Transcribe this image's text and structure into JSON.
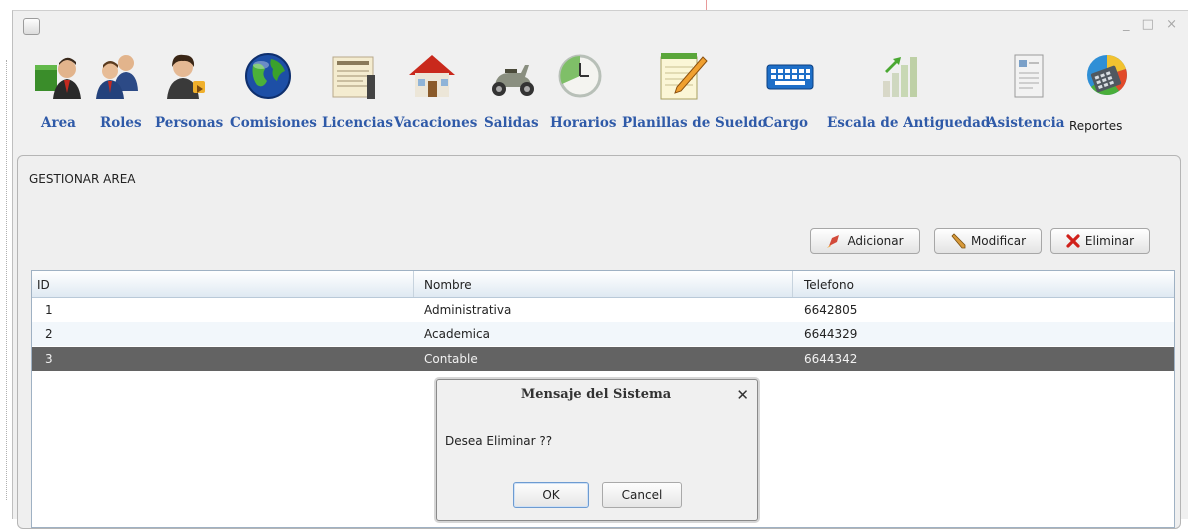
{
  "window": {
    "controls": "_ □ ×"
  },
  "toolbar": {
    "items": [
      {
        "label": "Area",
        "icon": "area-people-icon"
      },
      {
        "label": "Roles",
        "icon": "roles-people-icon"
      },
      {
        "label": "Personas",
        "icon": "personas-icon"
      },
      {
        "label": "Comisiones",
        "icon": "globe-icon"
      },
      {
        "label": "Licencias",
        "icon": "document-icon"
      },
      {
        "label": "Vacaciones",
        "icon": "house-icon"
      },
      {
        "label": "Salidas",
        "icon": "scooter-icon"
      },
      {
        "label": "Horarios",
        "icon": "clock-icon"
      },
      {
        "label": "Planillas de Sueldo",
        "icon": "notepad-pencil-icon"
      },
      {
        "label": "Cargo",
        "icon": "keyboard-icon"
      },
      {
        "label": "Escala de Antiguedad",
        "icon": "bar-chart-icon"
      },
      {
        "label": "Asistencia",
        "icon": "attendance-sheet-icon"
      },
      {
        "label": "Reportes",
        "icon": "calculator-pie-icon"
      }
    ]
  },
  "panel": {
    "title": "GESTIONAR AREA",
    "buttons": {
      "add": "Adicionar",
      "edit": "Modificar",
      "delete": "Eliminar"
    }
  },
  "table": {
    "columns": [
      "ID",
      "Nombre",
      "Telefono"
    ],
    "rows": [
      {
        "id": "1",
        "nombre": "Administrativa",
        "telefono": "6642805"
      },
      {
        "id": "2",
        "nombre": "Academica",
        "telefono": "6644329"
      },
      {
        "id": "3",
        "nombre": "Contable",
        "telefono": "6644342"
      }
    ],
    "selected_row": 3
  },
  "dialog": {
    "title": "Mensaje del Sistema",
    "message": "Desea Eliminar ??",
    "ok": "OK",
    "cancel": "Cancel"
  },
  "colors": {
    "toolbar_label": "#2f5aa8",
    "selected_row": "#636363",
    "delete_icon": "#d0201a"
  }
}
